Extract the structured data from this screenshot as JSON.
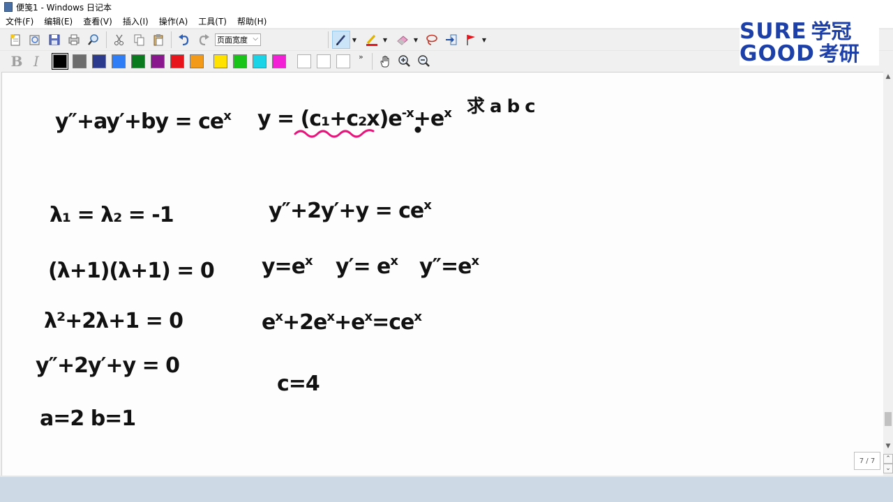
{
  "window": {
    "title": "便笺1 - Windows 日记本"
  },
  "menu": [
    {
      "label": "文件(F)"
    },
    {
      "label": "编辑(E)"
    },
    {
      "label": "查看(V)"
    },
    {
      "label": "插入(I)"
    },
    {
      "label": "操作(A)"
    },
    {
      "label": "工具(T)"
    },
    {
      "label": "帮助(H)"
    }
  ],
  "toolbar": {
    "zoom_value": "页面宽度",
    "more": "»"
  },
  "colors": {
    "swatches": [
      "#000000",
      "#6d6d6d",
      "#2b3a8c",
      "#2f7df6",
      "#0a7a1e",
      "#8a168e",
      "#e8141b",
      "#f39a18",
      "#ffe200",
      "#19c419",
      "#18d4e6",
      "#f21fd6"
    ],
    "pen_accent": "#e8137b",
    "logo_blue": "#1c3fa8"
  },
  "logo": {
    "line1": "SURE",
    "line1_cn": "学冠",
    "line2": "GOOD",
    "line2_cn": "考研"
  },
  "notes": {
    "left": [
      "y″+ay′+by = ce",
      "λ₁ = λ₂ = -1",
      "(λ+1)(λ+1) = 0",
      "λ²+2λ+1 = 0",
      "y″+2y′+y = 0",
      "a=2   b=1"
    ],
    "left_sup": "x",
    "right": [
      "y = (c₁+c₂x)e",
      "+e",
      "求 a  b  c",
      "y″+2y′+y = ce",
      "y=e",
      "y′= e",
      "y″=e",
      "e",
      "+2e",
      "+e",
      "=ce",
      "c=4"
    ],
    "sup_neg_x": "-x",
    "sup_x": "x"
  },
  "page_indicator": "7 / 7"
}
